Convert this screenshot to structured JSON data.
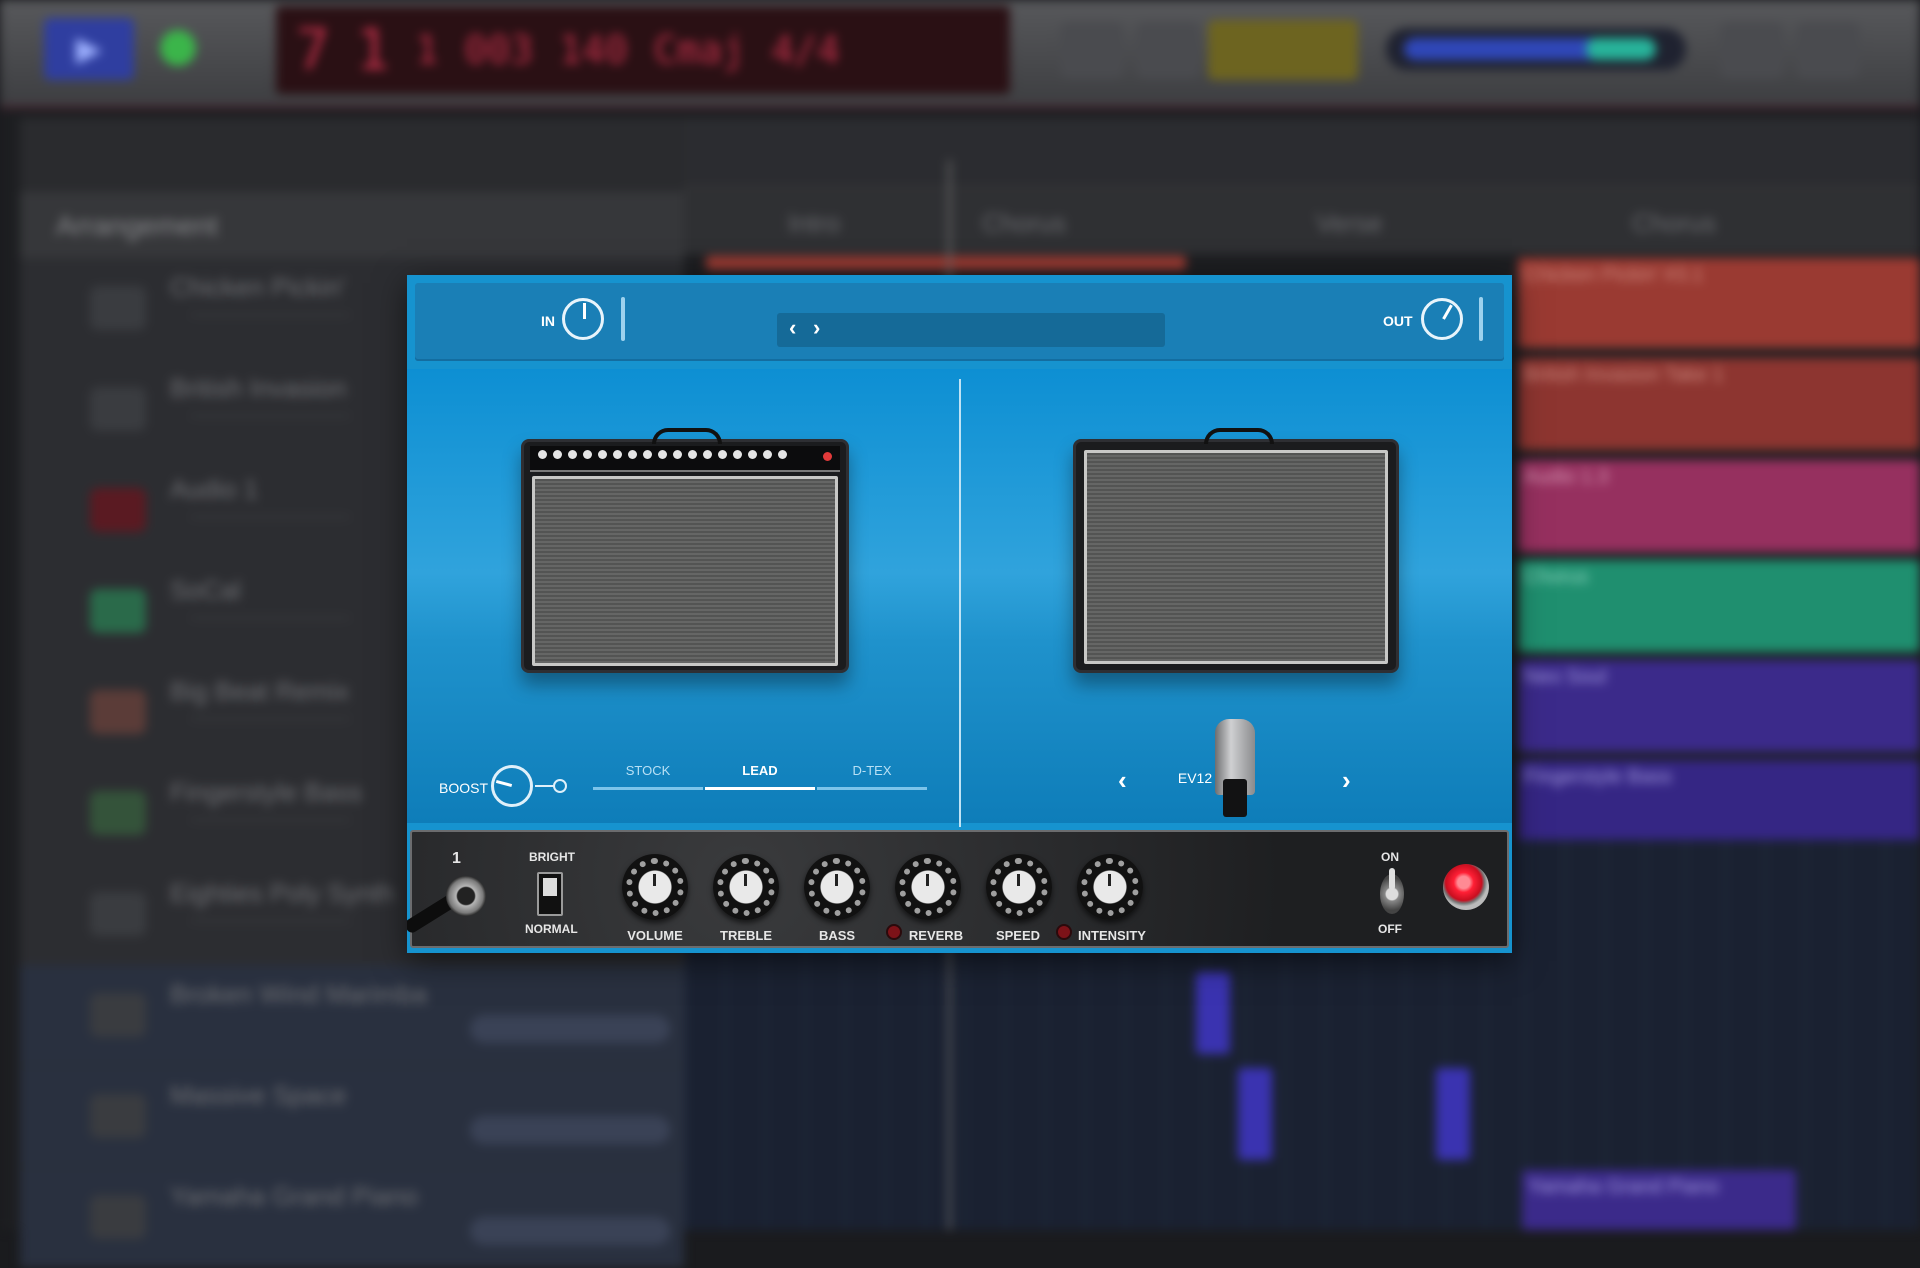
{
  "background": {
    "transport": {
      "lcd_bars": "7",
      "lcd_beats": "1",
      "lcd_sub": "1",
      "lcd_tick": "003",
      "lcd_tempo": "140",
      "lcd_key": "Cmaj",
      "lcd_sig": "4/4"
    },
    "arrangement_label": "Arrangement",
    "markers": [
      "Intro",
      "Chorus",
      "Verse",
      "Chorus"
    ],
    "tracks": [
      "Chicken Pickin'",
      "British Invasion",
      "Audio 1",
      "SoCal",
      "Big Beat Remix",
      "Fingerstyle Bass",
      "Eighties Poly Synth",
      "Broken Wind Marimba",
      "Massive Space",
      "Yamaha Grand Piano"
    ],
    "regions": [
      "Chicken Pickin' #3.1",
      "British Invasion Take 1",
      "Audio 1.3",
      "Chorus",
      "Neo Soul",
      "Fingerstyle Bass",
      "Yamaha Grand Piano"
    ],
    "colors": {
      "region_red": "#9a3a32",
      "region_magenta": "#96305f",
      "region_green": "#1f8f6f",
      "region_purple": "#3b2a8a",
      "plugin_blue": "#1693cf"
    }
  },
  "plugin": {
    "in_label": "IN",
    "out_label": "OUT",
    "preset_prev_icon": "chevron-left",
    "preset_next_icon": "chevron-right",
    "boost_label": "BOOST",
    "modes": [
      "STOCK",
      "LEAD",
      "D-TEX"
    ],
    "active_mode": "LEAD",
    "cabinet_name": "EV12",
    "controls": {
      "input_number": "1",
      "bright_label": "BRIGHT",
      "normal_label": "NORMAL",
      "knobs": [
        "VOLUME",
        "TREBLE",
        "BASS",
        "REVERB",
        "SPEED",
        "INTENSITY"
      ],
      "on_label": "ON",
      "off_label": "OFF"
    }
  }
}
